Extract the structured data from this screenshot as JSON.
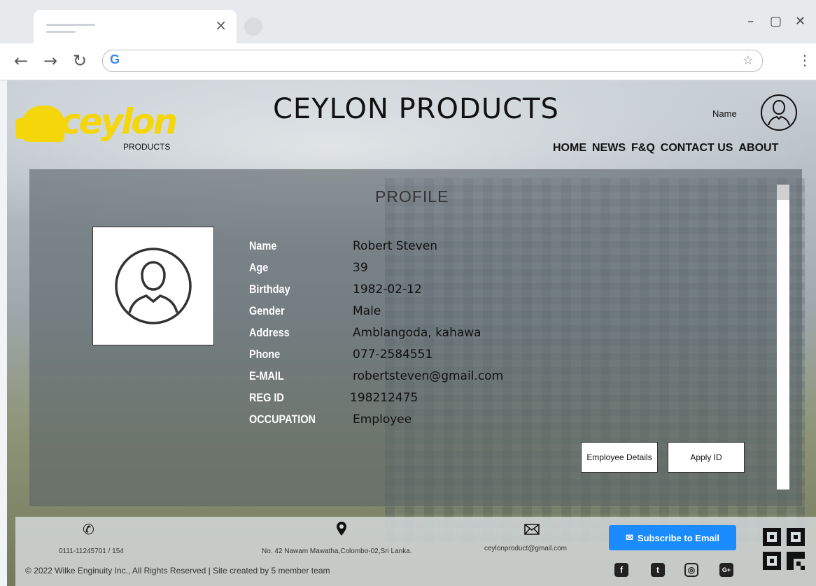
{
  "browser": {
    "tab_close": "×",
    "minimize": "–",
    "restore": "▢",
    "close": "✕",
    "back": "←",
    "forward": "→",
    "reload": "↻",
    "google_g": "G",
    "bookmark_star": "☆",
    "menu": "⋮"
  },
  "header": {
    "logo_word": "ceylon",
    "logo_sub": "PRODUCTS",
    "site_title": "CEYLON PRODUCTS",
    "user_name": "Name",
    "nav": [
      "HOME",
      "NEWS",
      "F&Q",
      "CONTACT US",
      "ABOUT"
    ]
  },
  "profile": {
    "title": "PROFILE",
    "fields": [
      {
        "label": "Name",
        "value": "Robert Steven"
      },
      {
        "label": "Age",
        "value": "39"
      },
      {
        "label": "Birthday",
        "value": "1982-02-12"
      },
      {
        "label": "Gender",
        "value": "Male"
      },
      {
        "label": "Address",
        "value": "Amblangoda, kahawa"
      },
      {
        "label": "Phone",
        "value": "077-2584551"
      },
      {
        "label": "E-MAIL",
        "value": "robertsteven@gmail.com"
      },
      {
        "label": "REG ID",
        "value": "198212475"
      },
      {
        "label": "OCCUPATION",
        "value": "Employee"
      }
    ],
    "buttons": {
      "employee_details": "Employee Details",
      "apply_id": "Apply ID"
    }
  },
  "footer": {
    "phone": "0111-11245701 / 154",
    "address": "No. 42 Nawam Mawatha,Colombo-02,Sri Lanka.",
    "email": "ceylonproduct@gmail.com",
    "subscribe": "Subscribe to Email",
    "copyright": "© 2022 Wilke Enginuity Inc., All Rights Reserved | Site created by 5 member team",
    "social": [
      "f",
      "t",
      "◎",
      "G+"
    ]
  },
  "colors": {
    "brand_yellow": "#f5d60a",
    "subscribe_blue": "#1a8cff"
  }
}
